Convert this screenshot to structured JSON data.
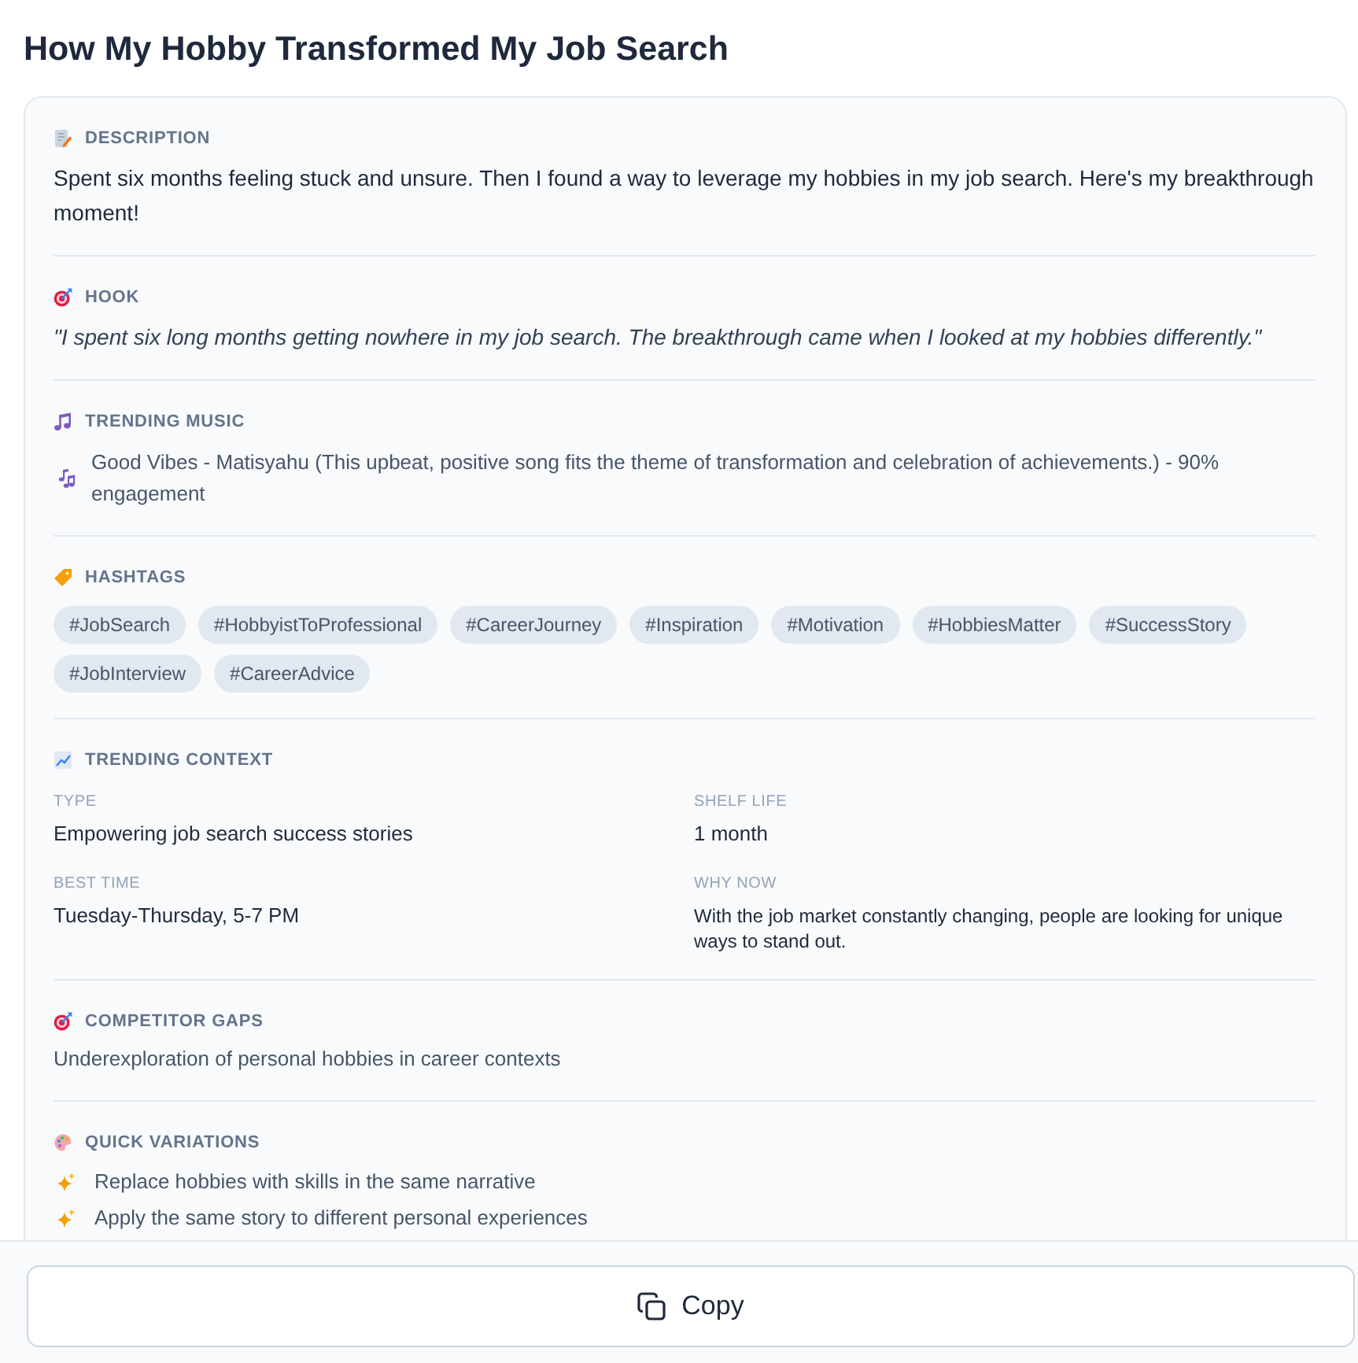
{
  "title": "How My Hobby Transformed My Job Search",
  "sections": [
    {
      "kind": "description",
      "label": "DESCRIPTION",
      "text": "Spent six months feeling stuck and unsure. Then I found a way to leverage my hobbies in my job search. Here's my breakthrough moment!"
    },
    {
      "kind": "hook",
      "label": "HOOK",
      "text": "\"I spent six long months getting nowhere in my job search. The breakthrough came when I looked at my hobbies differently.\""
    },
    {
      "kind": "music",
      "label": "TRENDING MUSIC",
      "text": "Good Vibes - Matisyahu (This upbeat, positive song fits the theme of transformation and celebration of achievements.) - 90% engagement"
    },
    {
      "kind": "hashtags",
      "label": "HASHTAGS",
      "tags": [
        "#JobSearch",
        "#HobbyistToProfessional",
        "#CareerJourney",
        "#Inspiration",
        "#Motivation",
        "#HobbiesMatter",
        "#SuccessStory",
        "#JobInterview",
        "#CareerAdvice"
      ]
    },
    {
      "kind": "context",
      "label": "TRENDING CONTEXT",
      "fields": [
        {
          "kind": "value",
          "label": "TYPE",
          "value": "Empowering job search success stories"
        },
        {
          "kind": "value",
          "label": "SHELF LIFE",
          "value": "1 month"
        },
        {
          "kind": "value",
          "label": "BEST TIME",
          "value": "Tuesday-Thursday, 5-7 PM"
        },
        {
          "kind": "note",
          "label": "WHY NOW",
          "value": "With the job market constantly changing, people are looking for unique ways to stand out."
        }
      ]
    },
    {
      "kind": "gaps",
      "label": "COMPETITOR GAPS",
      "text": "Underexploration of personal hobbies in career contexts"
    },
    {
      "kind": "variations",
      "label": "QUICK VARIATIONS",
      "items": [
        "Replace hobbies with skills in the same narrative",
        "Apply the same story to different personal experiences"
      ]
    }
  ],
  "copy_button": {
    "label": "Copy"
  }
}
